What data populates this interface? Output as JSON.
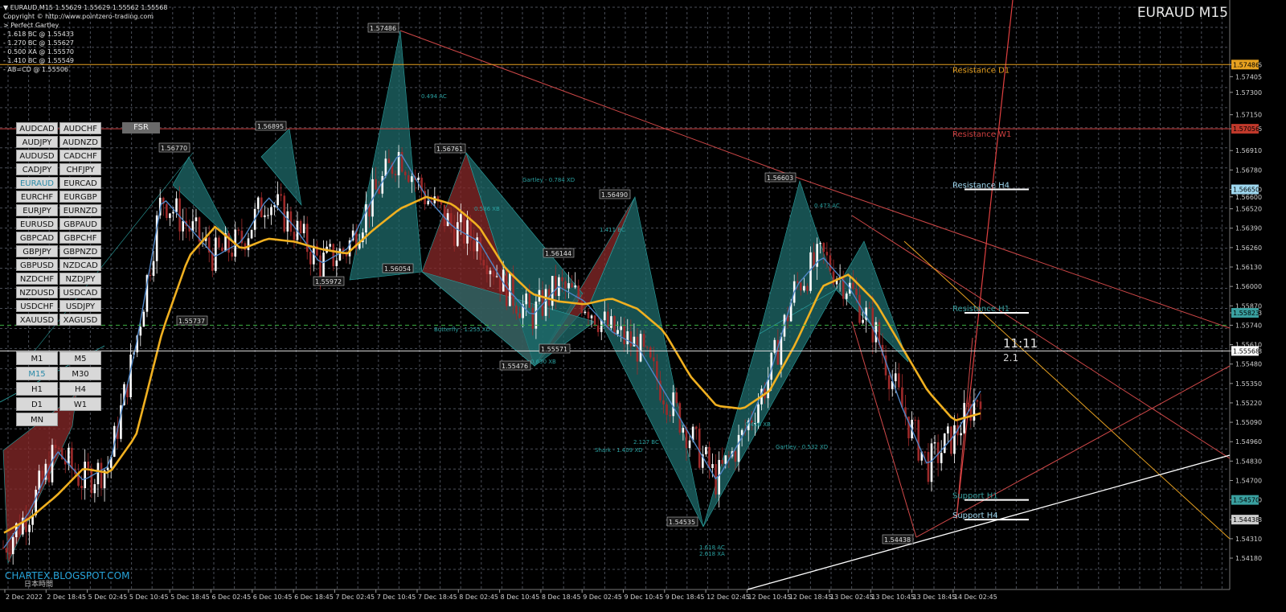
{
  "header": {
    "symbol_line": "▼ EURAUD,M15 1.55629 1.55629 1.55562 1.55568",
    "copyright": "Copyright © http://www.pointzero-trading.com",
    "pattern": "> Perfect Gartley",
    "levels": [
      "- 1.618 BC @ 1.55433",
      "- 1.270 BC @ 1.55627",
      "- 0.500 XA @ 1.55570",
      "- 1.410 BC @ 1.55549",
      "- AB=CD  @ 1.55506"
    ],
    "symbol_title": "EURAUD M15"
  },
  "symbol_panel": {
    "symbols": [
      "AUDCAD",
      "AUDCHF",
      "AUDJPY",
      "AUDNZD",
      "AUDUSD",
      "CADCHF",
      "CADJPY",
      "CHFJPY",
      "EURAUD",
      "EURCAD",
      "EURCHF",
      "EURGBP",
      "EURJPY",
      "EURNZD",
      "EURUSD",
      "GBPAUD",
      "GBPCAD",
      "GBPCHF",
      "GBPJPY",
      "GBPNZD",
      "GBPUSD",
      "NZDCAD",
      "NZDCHF",
      "NZDJPY",
      "NZDUSD",
      "USDCAD",
      "USDCHF",
      "USDJPY",
      "XAUUSD",
      "XAGUSD"
    ],
    "active_symbol": "EURAUD",
    "timeframes": [
      "M1",
      "M5",
      "M15",
      "M30",
      "H1",
      "H4",
      "D1",
      "W1",
      "MN"
    ],
    "active_timeframe": "M15",
    "fsr_label": "FSR"
  },
  "countdown": "11:11",
  "spread": "2.1",
  "watermark": "CHARTEX.BLOGSPOT.COM",
  "watermark_sub": "日本時間",
  "colors": {
    "background": "#000000",
    "grid": "#4a4e58",
    "up_candle": "#ffffff",
    "down_candle": "#9e2a2a",
    "ma_slow": "#f0b020",
    "ma_mid": "#4f86c6",
    "teal_pattern": "#1f6b6b",
    "red_pattern": "#8a2a2a"
  },
  "chart_data": {
    "type": "candlestick",
    "title": "EURAUD M15",
    "ylim": [
      1.5397,
      1.5787
    ],
    "x_labels": [
      "2 Dec 2022",
      "2 Dec 18:45",
      "5 Dec 02:45",
      "5 Dec 10:45",
      "5 Dec 18:45",
      "6 Dec 02:45",
      "6 Dec 10:45",
      "6 Dec 18:45",
      "7 Dec 02:45",
      "7 Dec 10:45",
      "7 Dec 18:45",
      "8 Dec 02:45",
      "8 Dec 10:45",
      "8 Dec 18:45",
      "9 Dec 02:45",
      "9 Dec 10:45",
      "9 Dec 18:45",
      "12 Dec 02:45",
      "12 Dec 10:45",
      "12 Dec 18:45",
      "13 Dec 02:45",
      "13 Dec 10:45",
      "13 Dec 18:45",
      "14 Dec 02:45"
    ],
    "y_ticks": [
      "1.57486",
      "1.57405",
      "1.57300",
      "1.57150",
      "1.57056",
      "1.56910",
      "1.56780",
      "1.56650",
      "1.56600",
      "1.56520",
      "1.56390",
      "1.56260",
      "1.56130",
      "1.56000",
      "1.55870",
      "1.55823",
      "1.55740",
      "1.55610",
      "1.55568",
      "1.55480",
      "1.55350",
      "1.55220",
      "1.55090",
      "1.54960",
      "1.54830",
      "1.54700",
      "1.54570",
      "1.54438",
      "1.54310",
      "1.54180"
    ],
    "price_tags": [
      {
        "value": 1.57486,
        "color": "#e6a020"
      },
      {
        "value": 1.57056,
        "color": "#c0392b"
      },
      {
        "value": 1.5665,
        "color": "#9fd8f0"
      },
      {
        "value": 1.55823,
        "color": "#3aa0a0"
      },
      {
        "value": 1.55568,
        "color": "#ffffff"
      },
      {
        "value": 1.5457,
        "color": "#3aa0a0"
      },
      {
        "value": 1.54438,
        "color": "#cccccc"
      }
    ],
    "levels": [
      {
        "name": "Resistance D1",
        "value": 1.57486,
        "color": "#e6a020"
      },
      {
        "name": "Resistance W1",
        "value": 1.57056,
        "color": "#d04040"
      },
      {
        "name": "Resistance H4",
        "value": 1.5665,
        "color": "#9fd8f0"
      },
      {
        "name": "Resistance H1",
        "value": 1.55823,
        "color": "#3aa0a0"
      },
      {
        "name": "Support H1",
        "value": 1.5457,
        "color": "#3aa0a0"
      },
      {
        "name": "Support H4",
        "value": 1.54438,
        "color": "#9fd8f0"
      }
    ],
    "swing_labels": [
      "1.57486",
      "1.56895",
      "1.56770",
      "1.56761",
      "1.56490",
      "1.56603",
      "1.56144",
      "1.56054",
      "1.55972",
      "1.55737",
      "1.55571",
      "1.55476",
      "1.54535",
      "1.54438"
    ],
    "annotations": [
      "0.494 AC",
      "0.473 AC",
      "1.411 BC",
      "2.127 BC",
      "0.416 XB",
      "0.586 XB",
      "0.630 XB",
      "Gartley - 0.532 XD",
      "Shark - 1.409 XD",
      "Butterfly - 1.255 XD",
      "Gartley - 0.784 XD",
      "1.618 AC",
      "2.618 XA"
    ],
    "ma_series": [
      {
        "name": "slow",
        "values": [
          1.5435,
          1.5445,
          1.546,
          1.5478,
          1.5475,
          1.55,
          1.557,
          1.562,
          1.564,
          1.5625,
          1.5632,
          1.563,
          1.5625,
          1.5622,
          1.5638,
          1.5652,
          1.566,
          1.5655,
          1.564,
          1.5612,
          1.5595,
          1.559,
          1.5588,
          1.5592,
          1.5585,
          1.557,
          1.554,
          1.552,
          1.5518,
          1.553,
          1.5562,
          1.56,
          1.5608,
          1.559,
          1.556,
          1.553,
          1.551,
          1.5515
        ]
      },
      {
        "name": "mid",
        "values": [
          1.5425,
          1.545,
          1.549,
          1.547,
          1.548,
          1.556,
          1.566,
          1.564,
          1.562,
          1.563,
          1.566,
          1.564,
          1.5615,
          1.5625,
          1.566,
          1.569,
          1.566,
          1.564,
          1.563,
          1.56,
          1.558,
          1.56,
          1.559,
          1.557,
          1.556,
          1.553,
          1.55,
          1.547,
          1.55,
          1.554,
          1.56,
          1.562,
          1.56,
          1.557,
          1.552,
          1.548,
          1.55,
          1.553
        ]
      }
    ]
  }
}
